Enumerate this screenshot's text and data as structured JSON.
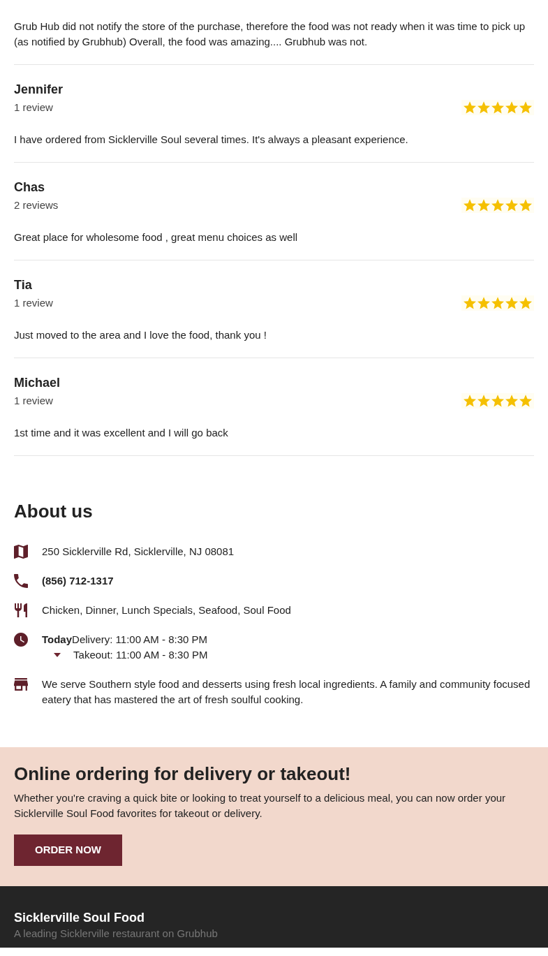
{
  "reviews": [
    {
      "text": "Grub Hub did not notify the store of the purchase, therefore the food was not ready when it was time to pick up (as notified by Grubhub) Overall, the food was amazing.... Grubhub was not."
    },
    {
      "name": "Jennifer",
      "count": "1 review",
      "stars": 5,
      "text": "I have ordered from Sicklerville Soul several times. It's always a pleasant experience."
    },
    {
      "name": "Chas",
      "count": "2 reviews",
      "stars": 5,
      "text": "Great place for wholesome food , great menu choices as well"
    },
    {
      "name": "Tia",
      "count": "1 review",
      "stars": 5,
      "text": "Just moved to the area and I love the food, thank you !"
    },
    {
      "name": "Michael",
      "count": "1 review",
      "stars": 5,
      "text": "1st time and it was excellent and I will go back"
    }
  ],
  "about": {
    "title": "About us",
    "rows": [
      {
        "kind": "address",
        "text": "250 Sicklerville Rd, Sicklerville, NJ 08081"
      },
      {
        "kind": "phone",
        "text": "(856) 712-1317"
      },
      {
        "kind": "cuisines",
        "text": "Chicken, Dinner, Lunch Specials, Seafood, Soul Food"
      },
      {
        "kind": "hours",
        "day": "Today",
        "lines": [
          "Delivery: 11:00 AM - 8:30 PM",
          "Takeout: 11:00 AM - 8:30 PM"
        ]
      },
      {
        "kind": "description",
        "text": "We serve Southern style food and desserts using fresh local ingredients. A family and community focused eatery that has mastered the art of fresh soulful cooking."
      }
    ]
  },
  "promo": {
    "title": "Online ordering for delivery or takeout!",
    "text": "Whether you're craving a quick bite or looking to treat yourself to a delicious meal, you can now order your Sicklerville Soul Food favorites for takeout or delivery.",
    "button": "ORDER NOW"
  },
  "footer": {
    "title": "Sicklerville Soul Food",
    "subtitle": "A leading Sicklerville restaurant on Grubhub"
  }
}
